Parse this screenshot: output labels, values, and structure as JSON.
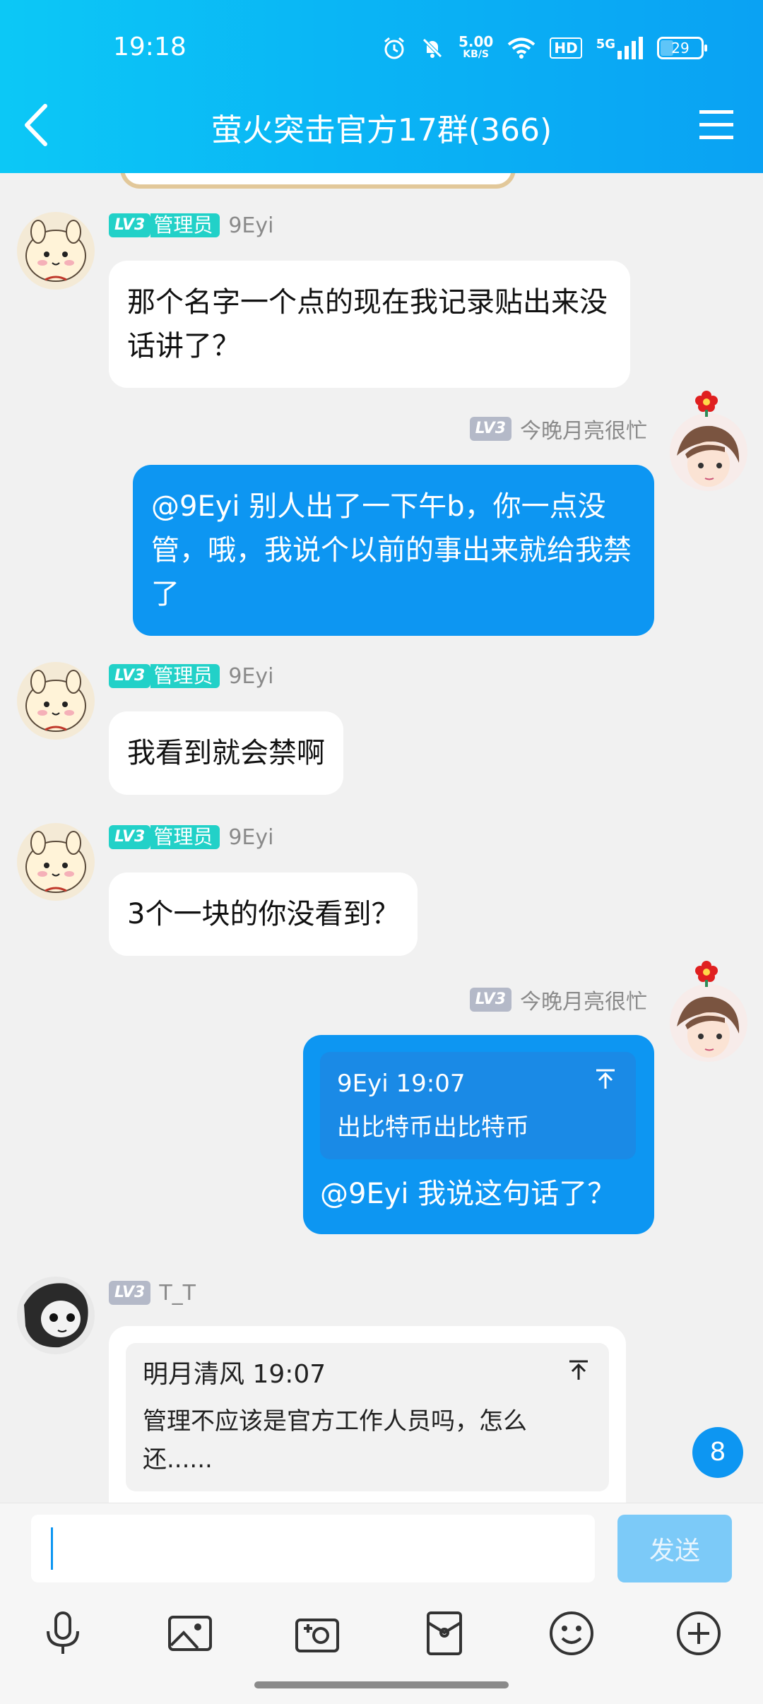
{
  "status_bar": {
    "time": "19:18",
    "net_speed_value": "5.00",
    "net_speed_unit": "KB/S",
    "hd_label": "HD",
    "signal_label": "5G",
    "battery": "29"
  },
  "header": {
    "title": "萤火突击官方17群(366)"
  },
  "messages": [
    {
      "level": "LV3",
      "role": "管理员",
      "sender": "9Eyi",
      "text": "那个名字一个点的现在我记录贴出来没话讲了？"
    },
    {
      "level": "LV3",
      "sender": "今晚月亮很忙",
      "text": "@9Eyi 别人出了一下午b，你一点没管，哦，我说个以前的事出来就给我禁了"
    },
    {
      "level": "LV3",
      "role": "管理员",
      "sender": "9Eyi",
      "text": "我看到就会禁啊"
    },
    {
      "level": "LV3",
      "role": "管理员",
      "sender": "9Eyi",
      "text": "3个一块的你没看到？"
    },
    {
      "level": "LV3",
      "sender": "今晚月亮很忙",
      "quote_author": "9Eyi 19:07",
      "quote_text": "出比特币出比特币",
      "text": "@9Eyi 我说这句话了？"
    },
    {
      "level": "LV3",
      "sender": "T_T",
      "quote_author": "明月清风 19:07",
      "quote_text": "管理不应该是官方工作人员吗，怎么还......"
    }
  ],
  "unread_count": "8",
  "input": {
    "placeholder": "",
    "value": "",
    "send_label": "发送"
  },
  "toolbar": [
    "mic-icon",
    "image-icon",
    "camera-icon",
    "red-packet-icon",
    "emoji-icon",
    "plus-icon"
  ]
}
